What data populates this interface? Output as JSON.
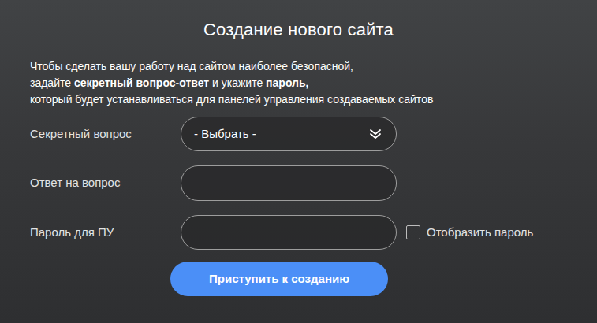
{
  "title": "Создание нового сайта",
  "intro": {
    "lines": [
      [
        {
          "text": "Чтобы сделать вашу работу над сайтом наиболее безопасной,",
          "bold": false
        }
      ],
      [
        {
          "text": "задайте ",
          "bold": false
        },
        {
          "text": "секретный вопрос-ответ",
          "bold": true
        },
        {
          "text": " и укажите ",
          "bold": false
        },
        {
          "text": "пароль,",
          "bold": true
        }
      ],
      [
        {
          "text": "который будет устанавливаться для панелей управления создаваемых сайтов",
          "bold": false
        }
      ]
    ]
  },
  "form": {
    "fields": [
      {
        "label": "Секретный вопрос",
        "kind": "select",
        "value": "- Выбрать -"
      },
      {
        "label": "Ответ на вопрос",
        "kind": "text"
      },
      {
        "label": "Пароль для ПУ",
        "kind": "password"
      }
    ],
    "show_password": {
      "label": "Отобразить пароль",
      "checked": false
    }
  },
  "submit": "Приступить к созданию"
}
